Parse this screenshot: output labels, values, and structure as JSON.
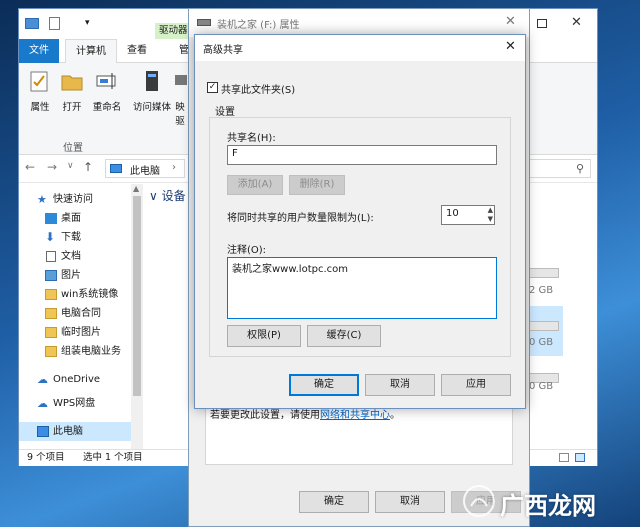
{
  "explorer": {
    "tabs": {
      "file": "文件",
      "computer": "计算机",
      "view": "查看",
      "manage": "管",
      "driver_tools": "驱动器"
    },
    "ribbon": {
      "buttons": [
        "属性",
        "打开",
        "重命名",
        "访问媒体",
        "映"
      ],
      "map_drive_partial": "驱",
      "group_label": "位置"
    },
    "address": {
      "location": "此电脑"
    },
    "main": {
      "section_header": "设备"
    },
    "nav": {
      "quick_access": "快速访问",
      "items": [
        {
          "label": "桌面",
          "pinned": true
        },
        {
          "label": "下载",
          "pinned": true
        },
        {
          "label": "文档",
          "pinned": true
        },
        {
          "label": "图片",
          "pinned": true
        },
        {
          "label": "win系统镜像",
          "pinned": false
        },
        {
          "label": "电脑合同",
          "pinned": false
        },
        {
          "label": "临时图片",
          "pinned": false
        },
        {
          "label": "组装电脑业务",
          "pinned": false
        }
      ],
      "onedrive": "OneDrive",
      "wps": "WPS网盘",
      "this_pc": "此电脑"
    },
    "drive_sizes": [
      "2 GB",
      "0 GB",
      "0 GB"
    ],
    "status": {
      "items": "9 个项目",
      "selected": "选中 1 个项目"
    }
  },
  "properties": {
    "title": "装机之家 (F:) 属性",
    "note_prefix": "若要更改此设置，请使用",
    "note_link": "网络和共享中心",
    "note_suffix": "。",
    "ok": "确定",
    "cancel": "取消",
    "apply": "应用"
  },
  "advanced": {
    "title": "高级共享",
    "share_checkbox": "共享此文件夹(S)",
    "share_checked": true,
    "settings_label": "设置",
    "share_name_label": "共享名(H):",
    "share_name_value": "F",
    "add_button": "添加(A)",
    "remove_button": "删除(R)",
    "limit_label": "将同时共享的用户数量限制为(L):",
    "limit_value": "10",
    "comment_label": "注释(O):",
    "comment_value": "装机之家www.lotpc.com",
    "permissions_button": "权限(P)",
    "caching_button": "缓存(C)",
    "ok": "确定",
    "cancel": "取消",
    "apply": "应用"
  },
  "watermark": {
    "text": "广西龙网"
  },
  "colors": {
    "accent": "#1979ca",
    "focus_border": "#0078d7",
    "link": "#0066cc"
  }
}
